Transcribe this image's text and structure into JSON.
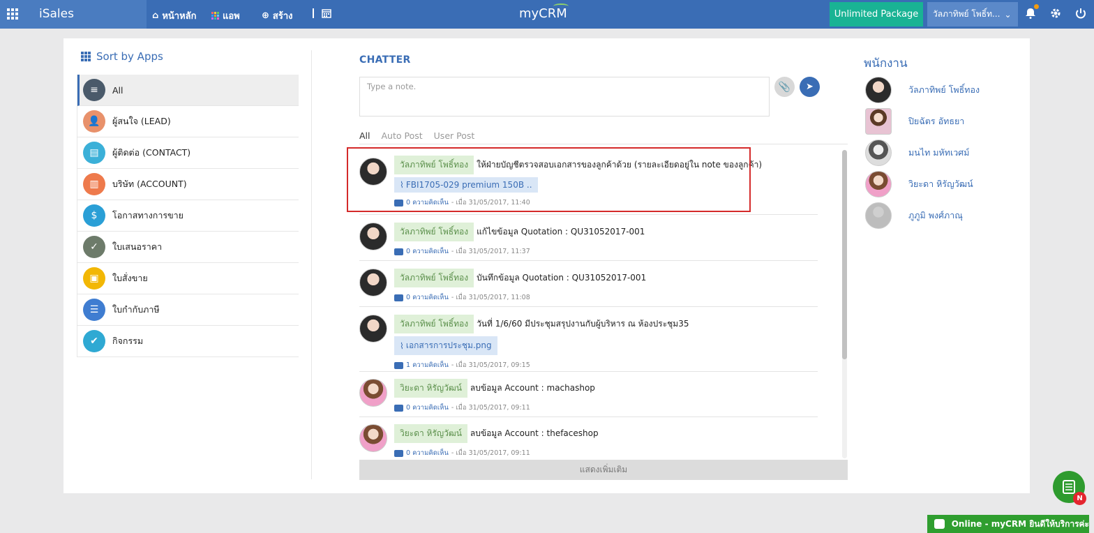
{
  "topbar": {
    "app_name": "iSales",
    "nav": {
      "home": "หน้าหลัก",
      "apps": "แอพ",
      "create": "สร้าง"
    },
    "logo": "myCRM",
    "package_button": "Unlimited Package",
    "user_menu": "วัลภาทิพย์ โพธิ์ท...",
    "colors": {
      "bar": "#3a6db5",
      "package": "#19b394"
    }
  },
  "sidebar": {
    "title": "Sort by Apps",
    "items": [
      {
        "label": "All",
        "icon": "list-icon",
        "color": "#4a5a6a"
      },
      {
        "label": "ผู้สนใจ (LEAD)",
        "icon": "lead-icon",
        "color": "#e8916b"
      },
      {
        "label": "ผู้ติดต่อ (CONTACT)",
        "icon": "contact-card-icon",
        "color": "#3bb0d8"
      },
      {
        "label": "บริษัท (ACCOUNT)",
        "icon": "building-icon",
        "color": "#ee7a4c"
      },
      {
        "label": "โอกาสทางการขาย",
        "icon": "opportunity-icon",
        "color": "#2a9fd6"
      },
      {
        "label": "ใบเสนอราคา",
        "icon": "clipboard-check-icon",
        "color": "#6d7b6a"
      },
      {
        "label": "ใบสั่งขาย",
        "icon": "order-icon",
        "color": "#f2b705"
      },
      {
        "label": "ใบกำกับภาษี",
        "icon": "invoice-icon",
        "color": "#3f7dd1"
      },
      {
        "label": "กิจกรรม",
        "icon": "calendar-check-icon",
        "color": "#2fa9d3"
      }
    ]
  },
  "chatter": {
    "title": "CHATTER",
    "note_placeholder": "Type a note.",
    "tabs": [
      "All",
      "Auto Post",
      "User Post"
    ],
    "posts": [
      {
        "author": "วัลภาทิพย์ โพธิ์ทอง",
        "text": "ให้ฝ่ายบัญชีตรวจสอบเอกสารของลูกค้าด้วย (รายละเอียดอยู่ใน note ของลูกค้า)",
        "attachment": "FBI1705-029 premium 150B ..",
        "comments": "0 ความคิดเห็น",
        "time": "- เมื่อ 31/05/2017, 11:40"
      },
      {
        "author": "วัลภาทิพย์ โพธิ์ทอง",
        "text": "แก้ไขข้อมูล Quotation : QU31052017-001",
        "attachment": "",
        "comments": "0 ความคิดเห็น",
        "time": "- เมื่อ 31/05/2017, 11:37"
      },
      {
        "author": "วัลภาทิพย์ โพธิ์ทอง",
        "text": "บันทึกข้อมูล Quotation : QU31052017-001",
        "attachment": "",
        "comments": "0 ความคิดเห็น",
        "time": "- เมื่อ 31/05/2017, 11:08"
      },
      {
        "author": "วัลภาทิพย์ โพธิ์ทอง",
        "text": "วันที่ 1/6/60 มีประชุมสรุปงานกับผู้บริหาร ณ ห้องประชุม35",
        "attachment": "เอกสารการประชุม.png",
        "comments": "1 ความคิดเห็น",
        "time": "- เมื่อ 31/05/2017, 09:15"
      },
      {
        "author": "วิยะดา หิรัญวัฒน์",
        "text": "ลบข้อมูล Account : machashop",
        "attachment": "",
        "comments": "0 ความคิดเห็น",
        "time": "- เมื่อ 31/05/2017, 09:11"
      },
      {
        "author": "วิยะดา หิรัญวัฒน์",
        "text": "ลบข้อมูล Account : thefaceshop",
        "attachment": "",
        "comments": "0 ความคิดเห็น",
        "time": "- เมื่อ 31/05/2017, 09:11"
      }
    ],
    "more_button": "แสดงเพิ่มเติม"
  },
  "employees": {
    "title": "พนักงาน",
    "list": [
      "วัลภาทิพย์ โพธิ์ทอง",
      "ปิยฉัตร อัทธยา",
      "มนไท มหัทเวศม์",
      "วิยะดา หิรัญวัฒน์",
      "ภูภูมิ พงศ์ภาณุ"
    ]
  },
  "floating": {
    "badge": "N",
    "online": "Online - myCRM ยินดีให้บริการค่ะ"
  }
}
